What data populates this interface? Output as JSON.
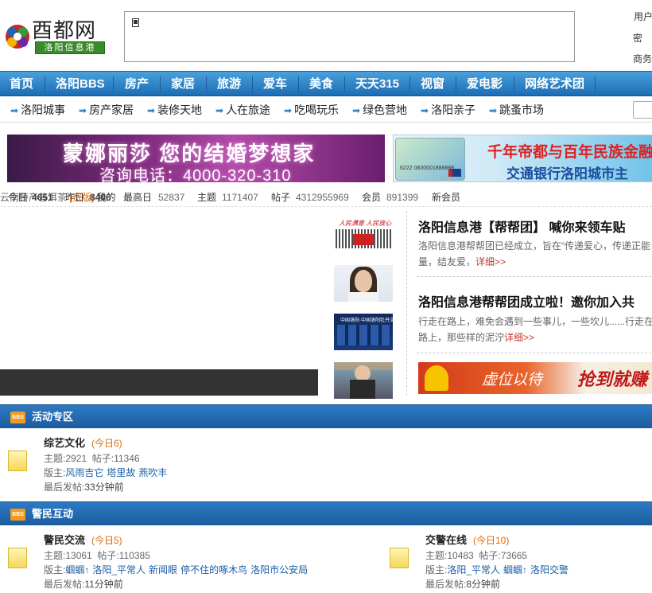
{
  "header": {
    "logo_text": "酉都网",
    "logo_sub": "洛阳信息港",
    "login": {
      "user_label": "用户",
      "pass_label": "密",
      "biz_label": "商务"
    }
  },
  "nav": {
    "items": [
      "首页",
      "洛阳BBS",
      "房产",
      "家居",
      "旅游",
      "爱车",
      "美食",
      "天天315",
      "视窗",
      "爱电影",
      "网络艺术团"
    ]
  },
  "subnav": {
    "items": [
      "洛阳城事",
      "房产家居",
      "装修天地",
      "人在旅途",
      "吃喝玩乐",
      "绿色营地",
      "洛阳亲子",
      "跳蚤市场"
    ]
  },
  "banners": {
    "b1_line1": "蒙娜丽莎  您的结婚梦想家",
    "b1_line2": "咨询电话：4000-320-310",
    "b2_line1": "千年帝都与百年民族金融品",
    "b2_line2": "交通银行洛阳城市主",
    "b2_card_num": "6222 0830001888888",
    "b3_line1": "虚位以待",
    "b3_line2": "抢到就赚"
  },
  "stats": {
    "today_label": "今日",
    "today": "4651",
    "yesterday_label": "昨日",
    "yesterday": "8406",
    "highest_label": "最高日",
    "highest": "52837",
    "topics_label": "主题",
    "topics": "1171407",
    "posts_label": "帖子",
    "posts": "4312955969",
    "members_label": "会员",
    "members": "891399",
    "newmember_label": "新会员",
    "newmember": "云南特产普洱茶",
    "wide_label": "[宽版]",
    "my_label": "我的"
  },
  "thumbs": {
    "t1_caption": "人民满意  人民放心",
    "t3_caption": "中国洛阳·中国洛阳牡丹文化节"
  },
  "news": [
    {
      "title": "洛阳信息港【帮帮团】 喊你来领车贴",
      "desc": "洛阳信息港帮帮团已经成立，旨在“传递爱心，传递正能量，结友爱，",
      "more": "详细>>"
    },
    {
      "title": "洛阳信息港帮帮团成立啦！邀你加入共",
      "desc": "行走在路上，难免会遇到一些事儿，一些坎儿......行走在路上，那些样的泥泞",
      "more": "详细>>"
    }
  ],
  "sections": [
    {
      "title": "活动专区",
      "icon": "BBS",
      "forums": [
        {
          "name": "综艺文化",
          "today": "(今日6)",
          "topics_label": "主题:",
          "topics": "2921",
          "posts_label": "帖子:",
          "posts": "11346",
          "mod_label": "版主:",
          "mods": [
            "风雨吉它",
            "塔里故",
            "燕吹丰"
          ],
          "last_label": "最后发帖:",
          "last": "33分钟前"
        }
      ]
    },
    {
      "title": "警民互动",
      "icon": "BBS",
      "forums": [
        {
          "name": "警民交流",
          "today": "(今日5)",
          "topics_label": "主题:",
          "topics": "13061",
          "posts_label": "帖子:",
          "posts": "110385",
          "mod_label": "版主:",
          "mods": [
            "蝈蝈↑",
            "洛阳_平常人",
            "新闻眼",
            "停不住的啄木鸟",
            "洛阳市公安局"
          ],
          "last_label": "最后发帖:",
          "last": "11分钟前"
        },
        {
          "name": "交警在线",
          "today": "(今日10)",
          "topics_label": "主题:",
          "topics": "10483",
          "posts_label": "帖子:",
          "posts": "73665",
          "mod_label": "版主:",
          "mods": [
            "洛阳_平常人",
            "蝈蝈↑",
            "洛阳交警"
          ],
          "last_label": "最后发帖:",
          "last": "8分钟前"
        }
      ]
    }
  ]
}
